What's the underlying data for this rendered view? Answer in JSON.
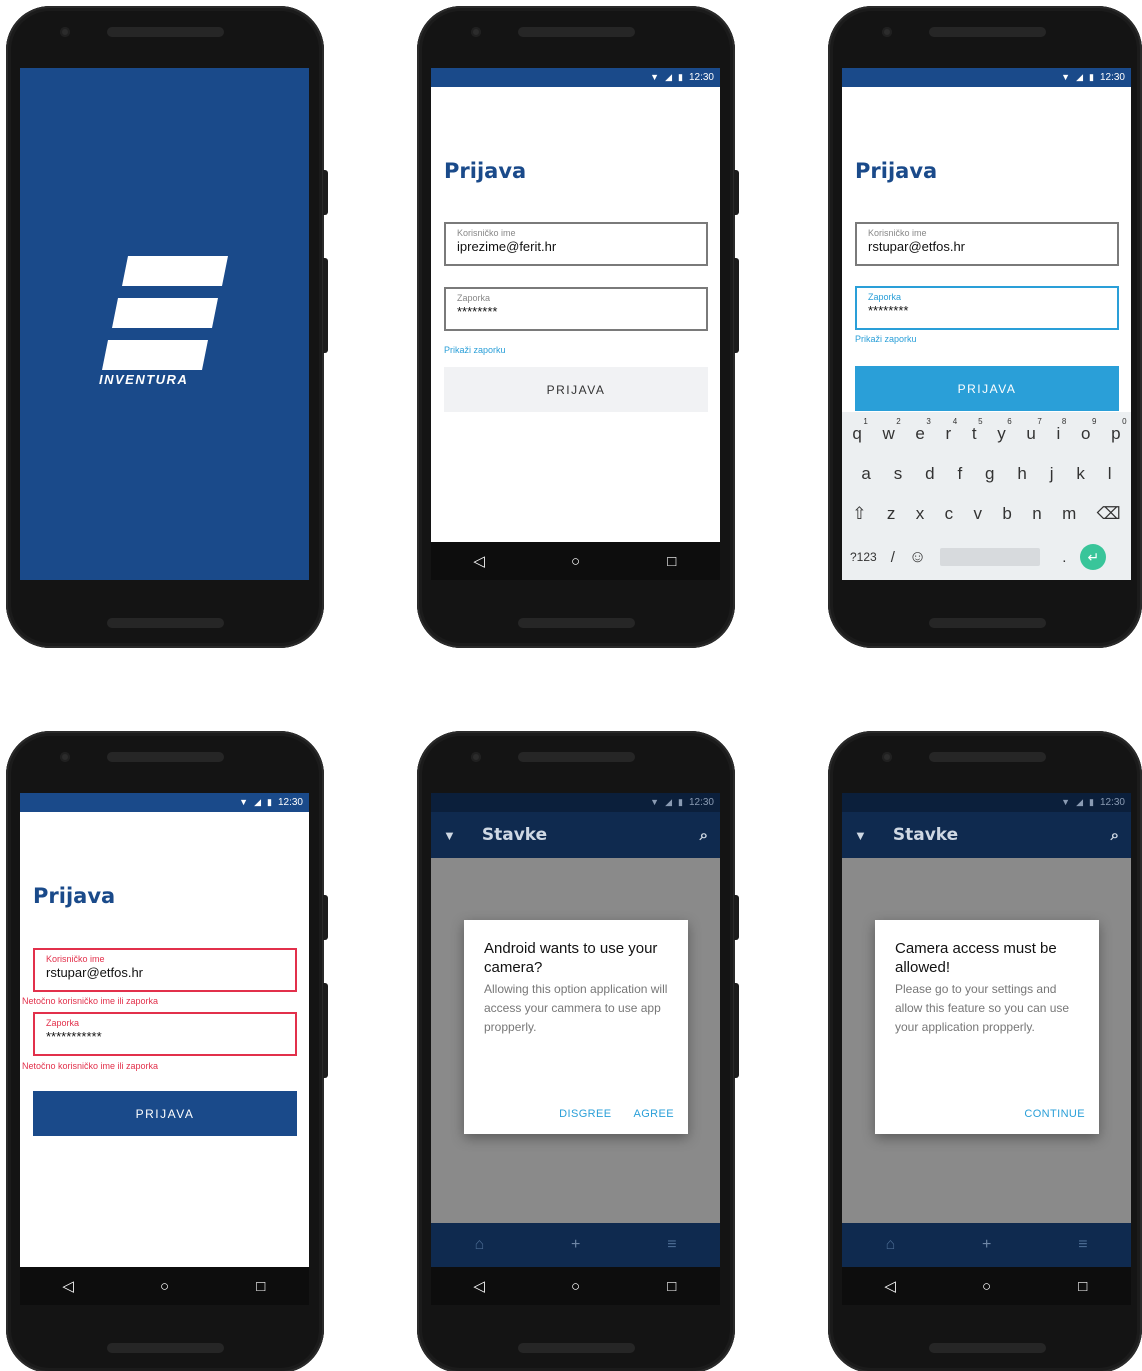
{
  "colors": {
    "brand": "#1a4a8a",
    "accent": "#2a9fd8",
    "error": "#e2304b"
  },
  "statusbar": {
    "time": "12:30",
    "wifi_icon": "▼",
    "signal_icon": "◢",
    "battery_icon": "▮"
  },
  "nav": {
    "back": "◁",
    "home": "○",
    "recents": "□"
  },
  "splash": {
    "logo_text": "INVENTURA"
  },
  "login1": {
    "title": "Prijava",
    "username_label": "Korisničko ime",
    "username_value": "iprezime@ferit.hr",
    "password_label": "Zaporka",
    "password_value": "********",
    "show_password": "Prikaži zaporku",
    "button": "PRIJAVA"
  },
  "login2": {
    "title": "Prijava",
    "username_label": "Korisničko ime",
    "username_value": "rstupar@etfos.hr",
    "password_label": "Zaporka",
    "password_value": "********",
    "show_password": "Prikaži zaporku",
    "button": "PRIJAVA"
  },
  "keyboard": {
    "row1": [
      "q",
      "w",
      "e",
      "r",
      "t",
      "y",
      "u",
      "i",
      "o",
      "p"
    ],
    "row1_digits": [
      "1",
      "2",
      "3",
      "4",
      "5",
      "6",
      "7",
      "8",
      "9",
      "0"
    ],
    "row2": [
      "a",
      "s",
      "d",
      "f",
      "g",
      "h",
      "j",
      "k",
      "l"
    ],
    "row3": [
      "⇧",
      "z",
      "x",
      "c",
      "v",
      "b",
      "n",
      "m",
      "⌫"
    ],
    "row4": {
      "num": "?123",
      "slash": "/",
      "emoji": "☺",
      "period": ".",
      "enter": "↵"
    }
  },
  "login3": {
    "title": "Prijava",
    "username_label": "Korisničko ime",
    "username_value": "rstupar@etfos.hr",
    "error": "Netočno korisničko ime ili zaporka",
    "password_label": "Zaporka",
    "password_value": "***********",
    "button": "PRIJAVA"
  },
  "stavke": {
    "title": "Stavke",
    "filter_icon": "▼",
    "search_icon": "⌕",
    "dialog1": {
      "title": "Android wants to use your camera?",
      "body": "Allowing this option application will access your cammera to use app propperly.",
      "disagree": "DISGREE",
      "agree": "AGREE"
    },
    "dialog2": {
      "title": "Camera access must be allowed!",
      "body": "Please go to your settings and allow this feature so you can use your application propperly.",
      "continue": "CONTINUE"
    },
    "bottom_icons": {
      "scan": "⌂",
      "add": "+",
      "list": "≡"
    }
  }
}
